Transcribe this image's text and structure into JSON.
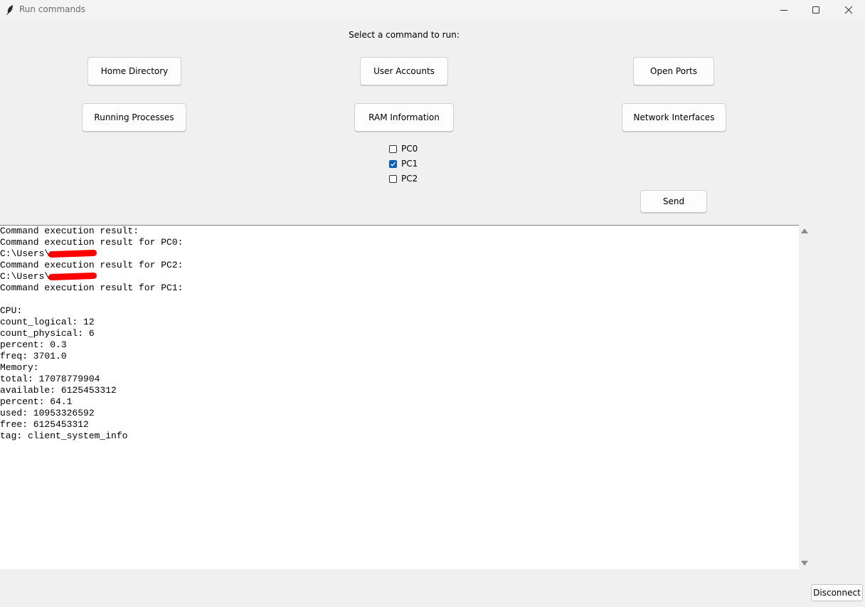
{
  "window": {
    "title": "Run commands",
    "minimize_icon": "minimize-icon",
    "maximize_icon": "maximize-icon",
    "close_icon": "close-icon"
  },
  "prompt": "Select a command to run:",
  "commands": {
    "home_directory": "Home Directory",
    "user_accounts": "User Accounts",
    "open_ports": "Open Ports",
    "running_processes": "Running Processes",
    "ram_information": "RAM Information",
    "network_interfaces": "Network Interfaces"
  },
  "targets": [
    {
      "label": "PC0",
      "checked": false
    },
    {
      "label": "PC1",
      "checked": true
    },
    {
      "label": "PC2",
      "checked": false
    }
  ],
  "send_label": "Send",
  "disconnect_label": "Disconnect",
  "output": {
    "lines": [
      "Command execution result:",
      "Command execution result for PC0:",
      "C:\\Users\\",
      "Command execution result for PC2:",
      "C:\\Users\\",
      "Command execution result for PC1:",
      "",
      "CPU:",
      "count_logical: 12",
      "count_physical: 6",
      "percent: 0.3",
      "freq: 3701.0",
      "Memory:",
      "total: 17078779904",
      "available: 6125453312",
      "percent: 64.1",
      "used: 10953326592",
      "free: 6125453312",
      "tag: client_system_info"
    ]
  },
  "colors": {
    "accent": "#005fb8",
    "redaction": "#ff0000"
  }
}
